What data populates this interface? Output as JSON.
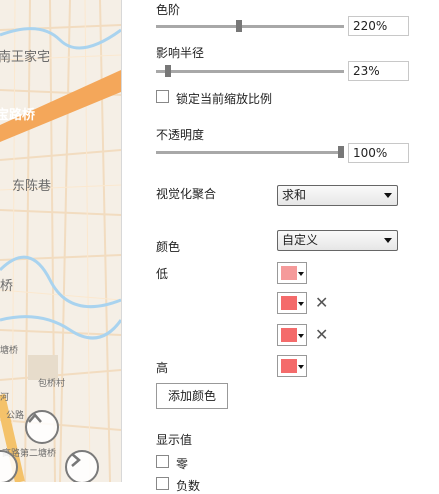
{
  "map": {
    "labels": {
      "l1": "南王家宅",
      "l2": "宝路桥",
      "l3": "东陈巷",
      "l4": "桥",
      "l5": "塘桥",
      "l6": "包桥村",
      "l7": "高路第二塘桥",
      "l8": "河",
      "l9": "公路"
    }
  },
  "panel": {
    "level": {
      "label": "色阶",
      "value": "220%",
      "level_fraction": 0.44
    },
    "radius": {
      "label": "影响半径",
      "value": "23%",
      "level_fraction": 0.05
    },
    "lock_scale": {
      "label": "锁定当前缩放比例",
      "checked": false
    },
    "opacity": {
      "label": "不透明度",
      "value": "100%",
      "level_fraction": 1.0
    },
    "aggregation": {
      "label": "视觉化聚合",
      "selected": "求和"
    },
    "color": {
      "label": "颜色",
      "selected": "自定义",
      "low_label": "低",
      "high_label": "高",
      "swatches": [
        "#f59a9a",
        "#f46b6b",
        "#f46b6b",
        "#f46b6b"
      ]
    },
    "add_color_button": "添加颜色",
    "display_values": {
      "label": "显示值",
      "zero_label": "零",
      "extra_label": "负数"
    }
  }
}
